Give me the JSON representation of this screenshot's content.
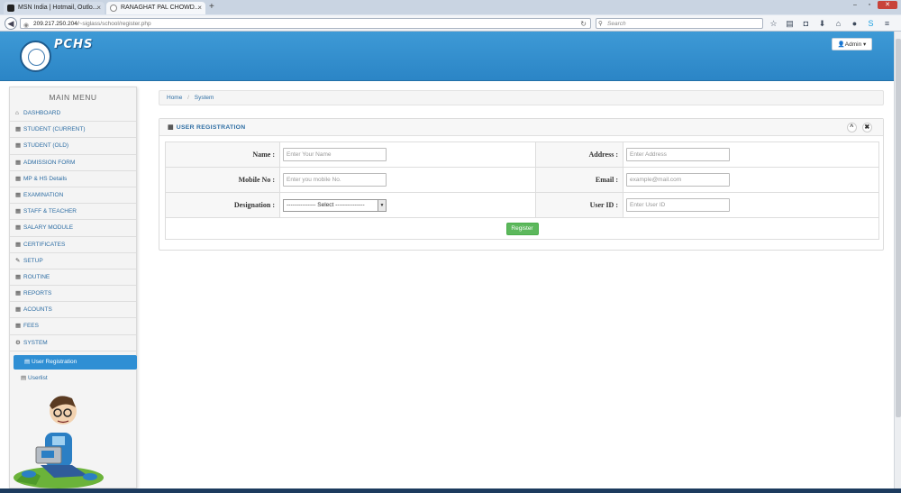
{
  "browser": {
    "tabs": [
      {
        "title": "MSN India | Hotmail, Outlo..."
      },
      {
        "title": "RANAGHAT PAL CHOWD..."
      }
    ],
    "new_tab": "+",
    "url_host": "209.217.250.204/",
    "url_path": "~siglass/school/register.php",
    "search_placeholder": "Search"
  },
  "header": {
    "brand": "PCHS",
    "admin_label": "Admin ▾"
  },
  "sidebar": {
    "title": "MAIN MENU",
    "items": [
      {
        "label": "DASHBOARD",
        "icon": "home-icon"
      },
      {
        "label": "STUDENT (CURRENT)",
        "icon": "grid-icon"
      },
      {
        "label": "STUDENT (OLD)",
        "icon": "grid-icon"
      },
      {
        "label": "ADMISSION FORM",
        "icon": "grid-icon"
      },
      {
        "label": "MP & HS Details",
        "icon": "grid-icon"
      },
      {
        "label": "EXAMINATION",
        "icon": "grid-icon"
      },
      {
        "label": "STAFF & TEACHER",
        "icon": "grid-icon"
      },
      {
        "label": "SALARY MODULE",
        "icon": "grid-icon"
      },
      {
        "label": "CERTIFICATES",
        "icon": "grid-icon"
      },
      {
        "label": "SETUP",
        "icon": "wrench-icon"
      },
      {
        "label": "ROUTINE",
        "icon": "grid-icon"
      },
      {
        "label": "REPORTS",
        "icon": "grid-icon"
      },
      {
        "label": "ACOUNTS",
        "icon": "grid-icon"
      },
      {
        "label": "FEES",
        "icon": "grid-icon"
      },
      {
        "label": "SYSTEM",
        "icon": "gears-icon"
      }
    ],
    "subitems": [
      {
        "label": "User Registration",
        "active": true
      },
      {
        "label": "Userlist",
        "active": false
      }
    ]
  },
  "breadcrumb": {
    "home": "Home",
    "separator": "/",
    "current": "System"
  },
  "panel": {
    "title": "USER REGISTRATION",
    "collapse": "^",
    "close": "✖"
  },
  "form": {
    "name_label": "Name :",
    "name_placeholder": "Enter Your Name",
    "address_label": "Address :",
    "address_placeholder": "Enter Address",
    "mobile_label": "Mobile No :",
    "mobile_placeholder": "Enter you mobile No.",
    "email_label": "Email :",
    "email_placeholder": "example@mail.com",
    "designation_label": "Designation :",
    "designation_selected": "--------------- Select ---------------",
    "userid_label": "User ID :",
    "userid_placeholder": "Enter User ID",
    "register_label": "Register"
  },
  "colors": {
    "header_blue": "#2b85c6",
    "link_blue": "#2d6da3",
    "active_blue": "#2f8fd4",
    "register_green": "#5cb85c"
  }
}
